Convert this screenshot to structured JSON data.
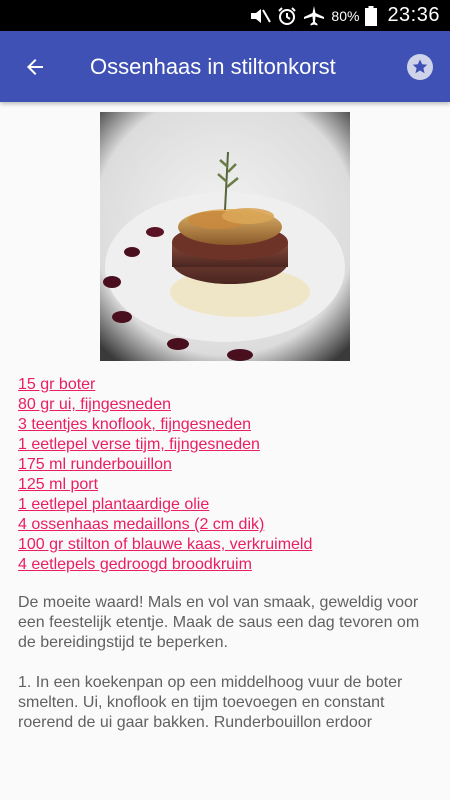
{
  "status_bar": {
    "icons": [
      "mute-icon",
      "alarm-icon",
      "airplane-icon",
      "battery-icon"
    ],
    "battery_percent": "80%",
    "time": "23:36"
  },
  "app_bar": {
    "title": "Ossenhaas in stiltonkorst",
    "colors": {
      "primary": "#3f51b5"
    }
  },
  "recipe": {
    "image_alt": "Ossenhaas in stiltonkorst",
    "ingredients": [
      "15 gr boter",
      "80 gr ui, fijngesneden",
      "3 teentjes knoflook, fijngesneden",
      "1 eetlepel verse tijm, fijngesneden",
      "175 ml runderbouillon",
      "125 ml port",
      "1 eetlepel plantaardige olie",
      "4 ossenhaas medaillons (2 cm dik)",
      "100 gr stilton of blauwe kaas, verkruimeld",
      "4 eetlepels gedroogd broodkruim"
    ],
    "description": "De moeite waard! Mals en vol van smaak, geweldig voor een feestelijk etentje. Maak de saus een dag tevoren om de bereidingstijd te beperken.\n\n1. In een koekenpan op een middelhoog vuur de boter smelten. Ui, knoflook en tijm toevoegen en constant roerend de ui gaar bakken. Runderbouillon erdoor",
    "link_color": "#e91e63"
  }
}
